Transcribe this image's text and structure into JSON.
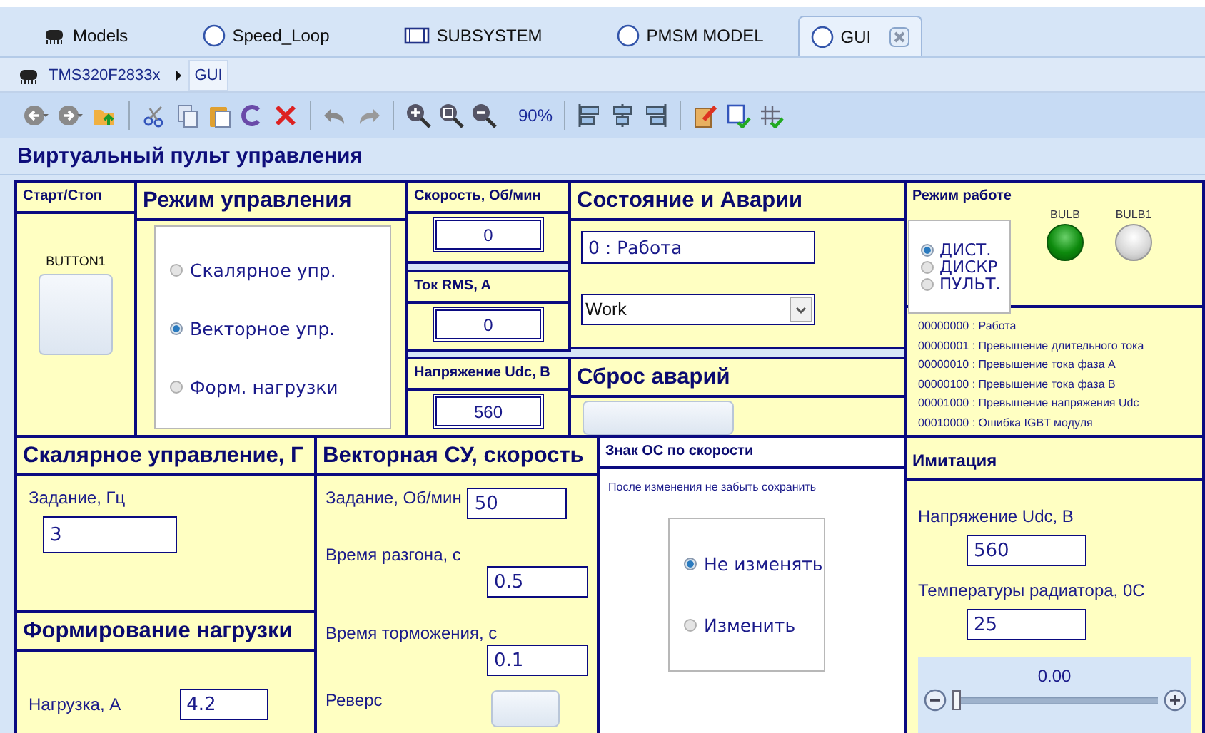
{
  "tabs": [
    {
      "label": "Models",
      "kind": "chip",
      "selected": false
    },
    {
      "label": "Speed_Loop",
      "kind": "chart",
      "selected": false
    },
    {
      "label": "SUBSYSTEM",
      "kind": "subsystem",
      "selected": false
    },
    {
      "label": "PMSM MODEL",
      "kind": "chart",
      "selected": false
    },
    {
      "label": "GUI",
      "kind": "chart",
      "selected": true
    }
  ],
  "breadcrumb": [
    "TMS320F2833x",
    "GUI"
  ],
  "toolbar": {
    "zoom": "90%"
  },
  "page_title": "Виртуальный пульт управления",
  "start_stop": {
    "title": "Старт/Стоп",
    "button_label": "BUTTON1"
  },
  "control_mode": {
    "title": "Режим  управления",
    "options": [
      {
        "label": "Скалярное упр.",
        "selected": false
      },
      {
        "label": "Векторное упр.",
        "selected": true
      },
      {
        "label": "Форм. нагрузки",
        "selected": false
      }
    ]
  },
  "speed": {
    "title": "Скорость, Об/мин",
    "value": "0"
  },
  "current": {
    "title": "Ток RMS, A",
    "value": "0"
  },
  "voltage": {
    "title": "Напряжение Udc, В",
    "value": "560"
  },
  "status": {
    "title": "Состояние и Аварии",
    "state": "0 : Работа",
    "dropdown": "Work"
  },
  "reset": {
    "title": "Сброс аварий"
  },
  "work_mode": {
    "title": "Режим работе",
    "options": [
      {
        "label": "ДИСТ.",
        "selected": true
      },
      {
        "label": "ДИСКР",
        "selected": false
      },
      {
        "label": "ПУЛЬТ.",
        "selected": false
      }
    ],
    "lamps": [
      {
        "label": "BULB",
        "on": true
      },
      {
        "label": "BULB1",
        "on": false
      }
    ]
  },
  "fault_codes": [
    "00000000 : Работа",
    "00000001 : Превышение длительного тока",
    "00000010 : Превышение тока фаза А",
    "00000100 : Превышение тока фаза В",
    "00001000 : Превышение напряжения Udc",
    "00010000 : Ошибка IGBT модуля"
  ],
  "scalar": {
    "title": "Скалярное управление, Г",
    "label": "Задание, Гц",
    "value": "3"
  },
  "load": {
    "title": "Формирование нагрузки",
    "label": "Нагрузка, А",
    "value": "4.2"
  },
  "vector": {
    "title": "Векторная СУ, скорость",
    "fields": [
      {
        "label": "Задание, Об/мин",
        "value": "50"
      },
      {
        "label": "Время разгона, с",
        "value": "0.5"
      },
      {
        "label": "Время торможения, с",
        "value": "0.1"
      }
    ],
    "reverse_label": "Реверс"
  },
  "feedback": {
    "title": "Знак ОС по скорости",
    "note": "После изменения не забыть сохранить",
    "options": [
      {
        "label": "Не изменять",
        "selected": true
      },
      {
        "label": "Изменить",
        "selected": false
      }
    ]
  },
  "imitation": {
    "title": "Имитация",
    "fields": [
      {
        "label": "Напряжение Udc, В",
        "value": "560"
      },
      {
        "label": "Температуры радиатора, 0С",
        "value": "25"
      }
    ],
    "slider": {
      "value": "0.00",
      "level": 0
    }
  }
}
